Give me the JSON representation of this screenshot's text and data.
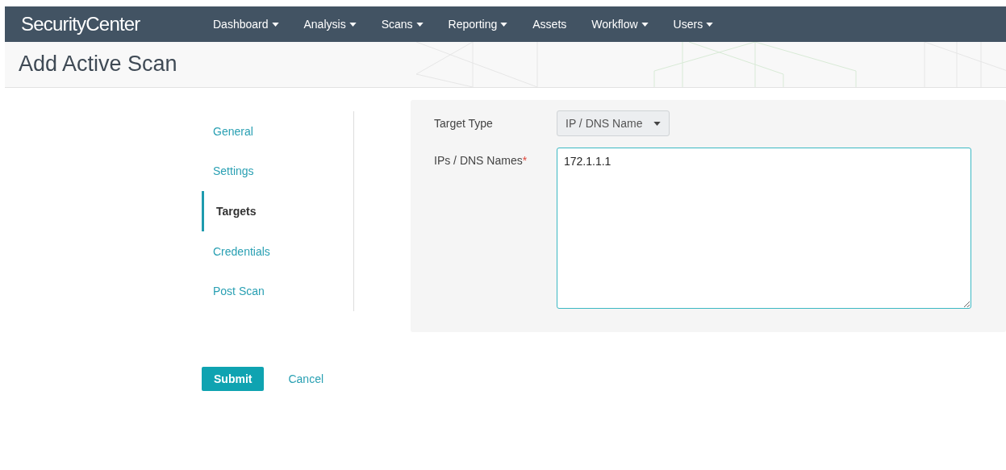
{
  "brand": "SecurityCenter",
  "nav": [
    {
      "label": "Dashboard",
      "dropdown": true
    },
    {
      "label": "Analysis",
      "dropdown": true
    },
    {
      "label": "Scans",
      "dropdown": true
    },
    {
      "label": "Reporting",
      "dropdown": true
    },
    {
      "label": "Assets",
      "dropdown": false
    },
    {
      "label": "Workflow",
      "dropdown": true
    },
    {
      "label": "Users",
      "dropdown": true
    }
  ],
  "page_title": "Add Active Scan",
  "steps": [
    {
      "label": "General",
      "selected": false
    },
    {
      "label": "Settings",
      "selected": false
    },
    {
      "label": "Targets",
      "selected": true
    },
    {
      "label": "Credentials",
      "selected": false
    },
    {
      "label": "Post Scan",
      "selected": false
    }
  ],
  "form": {
    "target_type": {
      "label": "Target Type",
      "value": "IP / DNS Name"
    },
    "targets": {
      "label": "IPs / DNS Names",
      "required_mark": "*",
      "value": "172.1.1.1"
    }
  },
  "buttons": {
    "submit": "Submit",
    "cancel": "Cancel"
  }
}
